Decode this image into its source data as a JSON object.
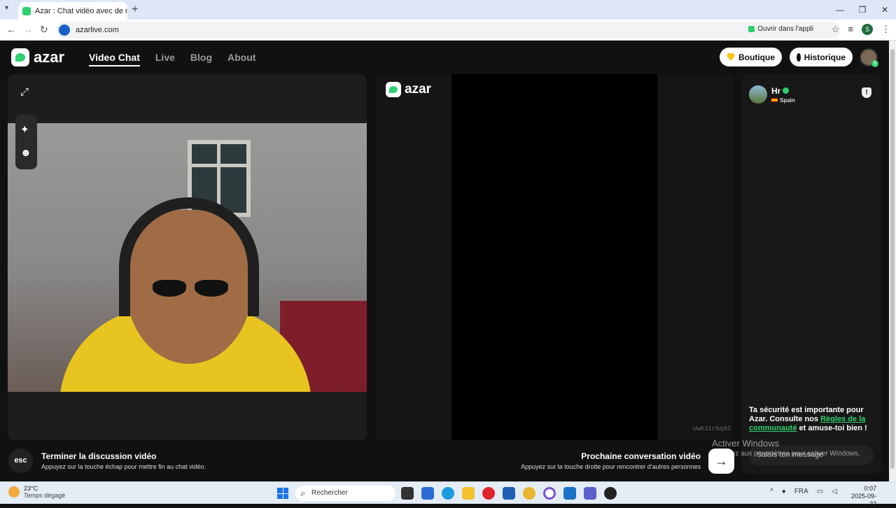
{
  "browser": {
    "tab_title": "Azar : Chat vidéo avec de n",
    "tab_close": "✕",
    "new_tab": "+",
    "url": "azarlive.com",
    "open_app": "Ouvrir dans l'appli",
    "profile_initial": "S"
  },
  "site": {
    "logo_text": "azar",
    "nav": [
      "Video Chat",
      "Live",
      "Blog",
      "About"
    ],
    "boutique": "Boutique",
    "historique": "Historique",
    "brand_color": "#2fd06f"
  },
  "remote": {
    "logo_text": "azar",
    "session_code": "UwK3irbq82"
  },
  "chat": {
    "peer_name": "Hr",
    "peer_country": "Spain",
    "safety_prefix": "Ta sécurité est importante pour Azar. Consulte nos ",
    "safety_link": "Règles de la communauté",
    "safety_suffix": " et amuse-toi bien !",
    "message_placeholder": "Saisis ton message"
  },
  "controls": {
    "esc_label": "esc",
    "end_title": "Terminer la discussion vidéo",
    "end_subtitle": "Appuyez sur la touche échap pour mettre fin au chat vidéo.",
    "next_title": "Prochaine conversation vidéo",
    "next_subtitle": "Appuyez sur la touche droite pour rencontrer d'autres personnes",
    "next_arrow": "→"
  },
  "watermark": {
    "title": "Activer Windows",
    "subtitle": "Accédez aux paramètres pour activer Windows."
  },
  "taskbar": {
    "temperature": "23°C",
    "weather": "Temps dégagé",
    "search": "Rechercher",
    "language": "FRA",
    "time": "0:07",
    "date": "2025-09-22"
  }
}
